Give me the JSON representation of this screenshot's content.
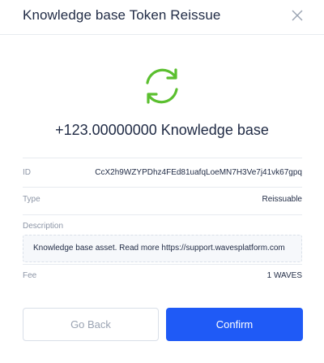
{
  "modal": {
    "title": "Knowledge base Token Reissue"
  },
  "summary": {
    "amount_text": "+123.00000000 Knowledge base"
  },
  "details": {
    "id_label": "ID",
    "id_value": "CcX2h9WZYPDhz4FEd81uafqLoeMN7H3Ve7j41vk67gpq",
    "type_label": "Type",
    "type_value": "Reissuable",
    "description_label": "Description",
    "description_value": "Knowledge base asset. Read more https://support.wavesplatform.com",
    "fee_label": "Fee",
    "fee_value": "1 WAVES"
  },
  "actions": {
    "back_label": "Go Back",
    "confirm_label": "Confirm"
  },
  "icons": {
    "close": "close-icon",
    "reissue": "refresh-icon"
  },
  "colors": {
    "accent": "#1f5af6",
    "icon_green": "#5bbf2f",
    "text_primary": "#1f2a44",
    "text_secondary": "#8c95a6"
  }
}
